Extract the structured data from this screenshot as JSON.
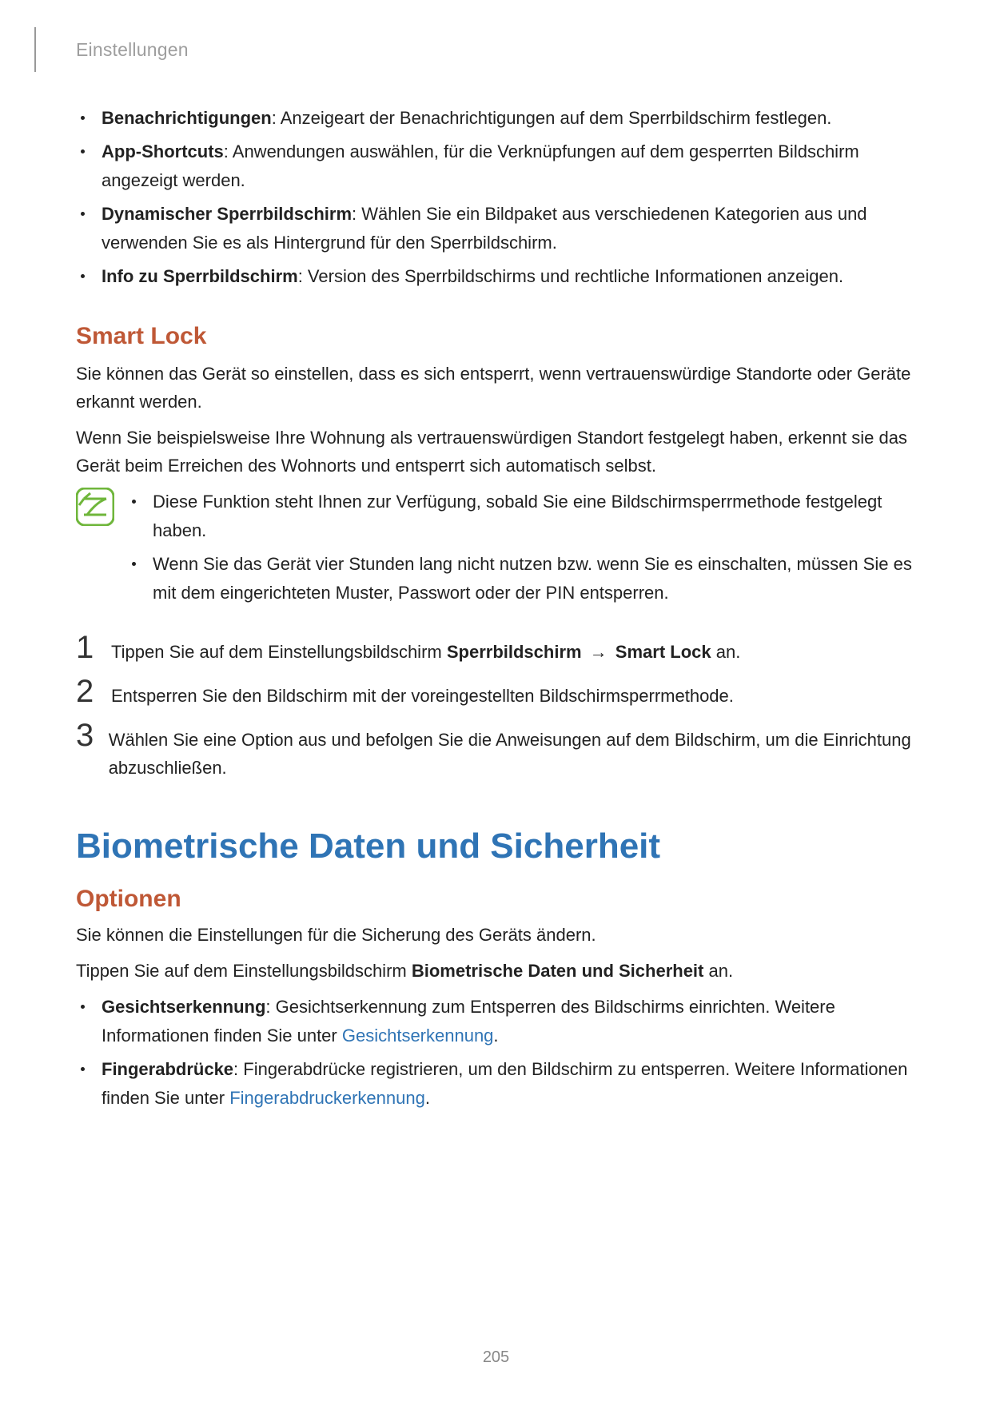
{
  "header": {
    "title": "Einstellungen"
  },
  "bullets": {
    "b1_bold": "Benachrichtigungen",
    "b1_text": ": Anzeigeart der Benachrichtigungen auf dem Sperrbildschirm festlegen.",
    "b2_bold": "App-Shortcuts",
    "b2_text": ": Anwendungen auswählen, für die Verknüpfungen auf dem gesperrten Bildschirm angezeigt werden.",
    "b3_bold": "Dynamischer Sperrbildschirm",
    "b3_text": ": Wählen Sie ein Bildpaket aus verschiedenen Kategorien aus und verwenden Sie es als Hintergrund für den Sperrbildschirm.",
    "b4_bold": "Info zu Sperrbildschirm",
    "b4_text": ": Version des Sperrbildschirms und rechtliche Informationen anzeigen."
  },
  "smartlock": {
    "title": "Smart Lock",
    "p1": "Sie können das Gerät so einstellen, dass es sich entsperrt, wenn vertrauenswürdige Standorte oder Geräte erkannt werden.",
    "p2": "Wenn Sie beispielsweise Ihre Wohnung als vertrauenswürdigen Standort festgelegt haben, erkennt sie das Gerät beim Erreichen des Wohnorts und entsperrt sich automatisch selbst.",
    "note1": "Diese Funktion steht Ihnen zur Verfügung, sobald Sie eine Bildschirmsperrmethode festgelegt haben.",
    "note2": "Wenn Sie das Gerät vier Stunden lang nicht nutzen bzw. wenn Sie es einschalten, müssen Sie es mit dem eingerichteten Muster, Passwort oder der PIN entsperren."
  },
  "steps": {
    "s1_pre": "Tippen Sie auf dem Einstellungsbildschirm ",
    "s1_b1": "Sperrbildschirm",
    "arrow": " → ",
    "s1_b2": "Smart Lock",
    "s1_post": " an.",
    "s2": "Entsperren Sie den Bildschirm mit der voreingestellten Bildschirmsperrmethode.",
    "s3": "Wählen Sie eine Option aus und befolgen Sie die Anweisungen auf dem Bildschirm, um die Einrichtung abzuschließen.",
    "n1": "1",
    "n2": "2",
    "n3": "3"
  },
  "bio": {
    "title": "Biometrische Daten und Sicherheit",
    "optionen": "Optionen",
    "p1": "Sie können die Einstellungen für die Sicherung des Geräts ändern.",
    "p2_pre": "Tippen Sie auf dem Einstellungsbildschirm ",
    "p2_bold": "Biometrische Daten und Sicherheit",
    "p2_post": " an.",
    "b1_bold": "Gesichtserkennung",
    "b1_text": ": Gesichtserkennung zum Entsperren des Bildschirms einrichten. Weitere Informationen finden Sie unter ",
    "b1_link": "Gesichtserkennung",
    "b1_end": ".",
    "b2_bold": "Fingerabdrücke",
    "b2_text": ": Fingerabdrücke registrieren, um den Bildschirm zu entsperren. Weitere Informationen finden Sie unter ",
    "b2_link": "Fingerabdruckerkennung",
    "b2_end": "."
  },
  "page_number": "205"
}
